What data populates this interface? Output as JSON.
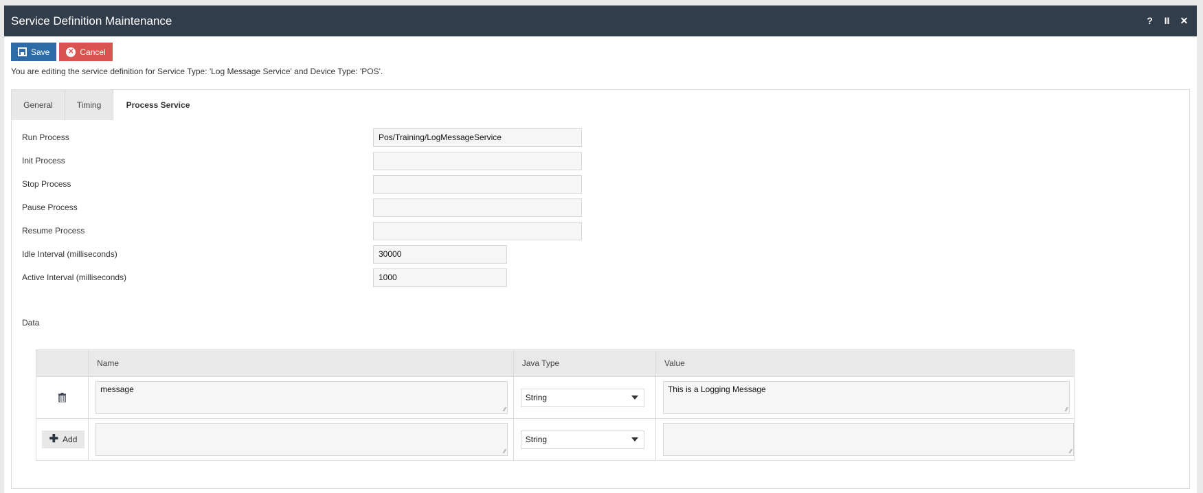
{
  "window": {
    "title": "Service Definition Maintenance",
    "controls": {
      "help": "?",
      "pause": "II",
      "close": "✕"
    }
  },
  "toolbar": {
    "save_label": "Save",
    "cancel_label": "Cancel"
  },
  "info_text": "You are editing the service definition for Service Type: 'Log Message Service' and Device Type: 'POS'.",
  "tabs": [
    {
      "label": "General",
      "active": false
    },
    {
      "label": "Timing",
      "active": false
    },
    {
      "label": "Process Service",
      "active": true
    }
  ],
  "form": {
    "run_process": {
      "label": "Run Process",
      "value": "Pos/Training/LogMessageService"
    },
    "init_process": {
      "label": "Init Process",
      "value": ""
    },
    "stop_process": {
      "label": "Stop Process",
      "value": ""
    },
    "pause_process": {
      "label": "Pause Process",
      "value": ""
    },
    "resume_process": {
      "label": "Resume Process",
      "value": ""
    },
    "idle_interval": {
      "label": "Idle Interval (milliseconds)",
      "value": "30000"
    },
    "active_interval": {
      "label": "Active Interval (milliseconds)",
      "value": "1000"
    }
  },
  "data_section": {
    "label": "Data",
    "columns": [
      "",
      "Name",
      "Java Type",
      "Value"
    ],
    "rows": [
      {
        "name": "message",
        "java_type": "String",
        "value": "This is a Logging Message"
      }
    ],
    "new_row": {
      "add_label": "Add",
      "name": "",
      "java_type": "String",
      "value": ""
    }
  },
  "icons": {
    "save": "floppy-disk-icon",
    "cancel": "times-circle-icon",
    "delete": "trash-icon",
    "add": "plus-icon"
  }
}
